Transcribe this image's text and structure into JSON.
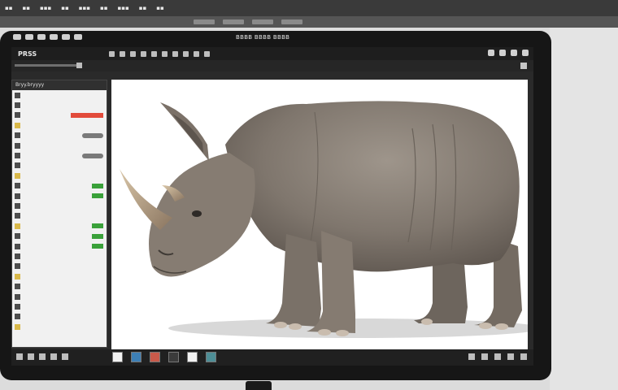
{
  "host": {
    "menus": [
      "",
      "",
      "",
      "",
      "",
      "",
      "",
      "",
      ""
    ]
  },
  "device": {
    "title": "BBBB BBBB BBBB"
  },
  "app": {
    "name": "PRSS",
    "toolbar_icons": [
      "",
      "",
      "",
      "",
      "",
      "",
      "",
      "",
      "",
      ""
    ]
  },
  "panel": {
    "title": "Bryy.bryyyy",
    "rows": [
      {
        "label": "",
        "icon": "layer-icon",
        "value": ""
      },
      {
        "label": "",
        "icon": "layer-icon",
        "value": ""
      },
      {
        "label": "",
        "icon": "layer-icon",
        "value": "red"
      },
      {
        "label": "",
        "icon": "layer-icon",
        "value": ""
      },
      {
        "label": "",
        "icon": "layer-icon",
        "value": "gray"
      },
      {
        "label": "",
        "icon": "layer-icon",
        "value": ""
      },
      {
        "label": "",
        "icon": "layer-icon",
        "value": "gray"
      },
      {
        "label": "",
        "icon": "layer-icon",
        "value": ""
      },
      {
        "label": "",
        "icon": "layer-icon",
        "value": ""
      },
      {
        "label": "",
        "icon": "layer-icon",
        "value": "green"
      },
      {
        "label": "",
        "icon": "layer-icon",
        "value": "green"
      },
      {
        "label": "",
        "icon": "layer-icon",
        "value": ""
      },
      {
        "label": "",
        "icon": "layer-icon",
        "value": ""
      },
      {
        "label": "",
        "icon": "layer-icon",
        "value": "green"
      },
      {
        "label": "",
        "icon": "layer-icon",
        "value": "green"
      },
      {
        "label": "",
        "icon": "layer-icon",
        "value": "green"
      },
      {
        "label": "",
        "icon": "layer-icon",
        "value": ""
      },
      {
        "label": "",
        "icon": "layer-icon",
        "value": ""
      },
      {
        "label": "",
        "icon": "layer-icon",
        "value": ""
      },
      {
        "label": "",
        "icon": "layer-icon",
        "value": ""
      },
      {
        "label": "",
        "icon": "layer-icon",
        "value": ""
      },
      {
        "label": "",
        "icon": "layer-icon",
        "value": ""
      },
      {
        "label": "",
        "icon": "layer-icon",
        "value": ""
      },
      {
        "label": "",
        "icon": "layer-icon",
        "value": ""
      }
    ]
  },
  "canvas": {
    "subject": "rhinoceros-photo"
  },
  "colors": {
    "accent_red": "#e24b3b",
    "accent_green": "#3aa13a",
    "chrome_dark": "#1e1e1e"
  }
}
